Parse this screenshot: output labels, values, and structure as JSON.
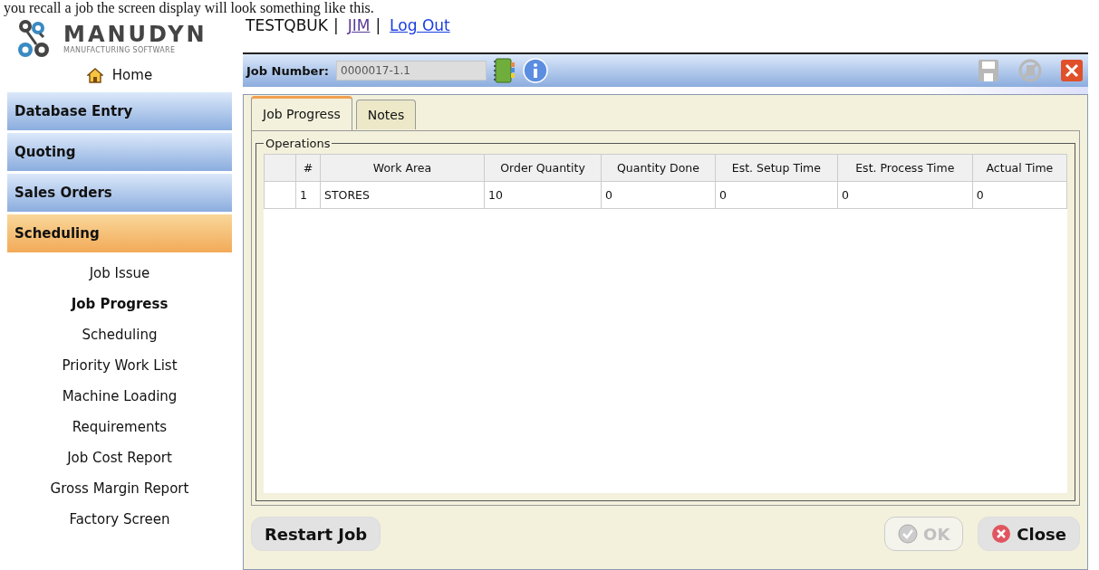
{
  "document_text": "you recall a job the screen display will look something like this.",
  "logo": {
    "name": "MANUDYN",
    "tagline": "MANUFACTURING SOFTWARE"
  },
  "home": {
    "label": "Home"
  },
  "user": {
    "company": "TESTQBUK",
    "separator": "|",
    "user_link": "JIM",
    "logout_link": "Log Out"
  },
  "sidebar": {
    "sections": [
      {
        "label": "Database Entry",
        "selected": false
      },
      {
        "label": "Quoting",
        "selected": false
      },
      {
        "label": "Sales Orders",
        "selected": false
      },
      {
        "label": "Scheduling",
        "selected": true
      }
    ],
    "items": [
      {
        "label": "Job Issue",
        "selected": false
      },
      {
        "label": "Job Progress",
        "selected": true
      },
      {
        "label": "Scheduling",
        "selected": false
      },
      {
        "label": "Priority Work List",
        "selected": false
      },
      {
        "label": "Machine Loading",
        "selected": false
      },
      {
        "label": "Requirements",
        "selected": false
      },
      {
        "label": "Job Cost Report",
        "selected": false
      },
      {
        "label": "Gross Margin Report",
        "selected": false
      },
      {
        "label": "Factory Screen",
        "selected": false
      }
    ]
  },
  "toolbar": {
    "job_number_label": "Job Number:",
    "job_number": "0000017-1.1",
    "actions": [
      {
        "kind": "save",
        "disabled": true
      },
      {
        "kind": "cancel",
        "disabled": true
      },
      {
        "kind": "close",
        "disabled": false
      }
    ]
  },
  "tabs": [
    {
      "label": "Job Progress",
      "selected": true
    },
    {
      "label": "Notes",
      "selected": false
    }
  ],
  "operations": {
    "legend": "Operations",
    "columns": [
      "#",
      "Work Area",
      "Order Quantity",
      "Quantity Done",
      "Est. Setup Time",
      "Est. Process Time",
      "Actual Time"
    ],
    "rows": [
      [
        "1",
        "STORES",
        "10",
        "0",
        "0",
        "0",
        "0"
      ]
    ]
  },
  "buttons": [
    {
      "kind": "restart",
      "label": "Restart Job",
      "disabled": false
    },
    {
      "kind": "ok",
      "label": "OK",
      "disabled": true
    },
    {
      "kind": "close",
      "label": "Close",
      "disabled": false
    }
  ]
}
